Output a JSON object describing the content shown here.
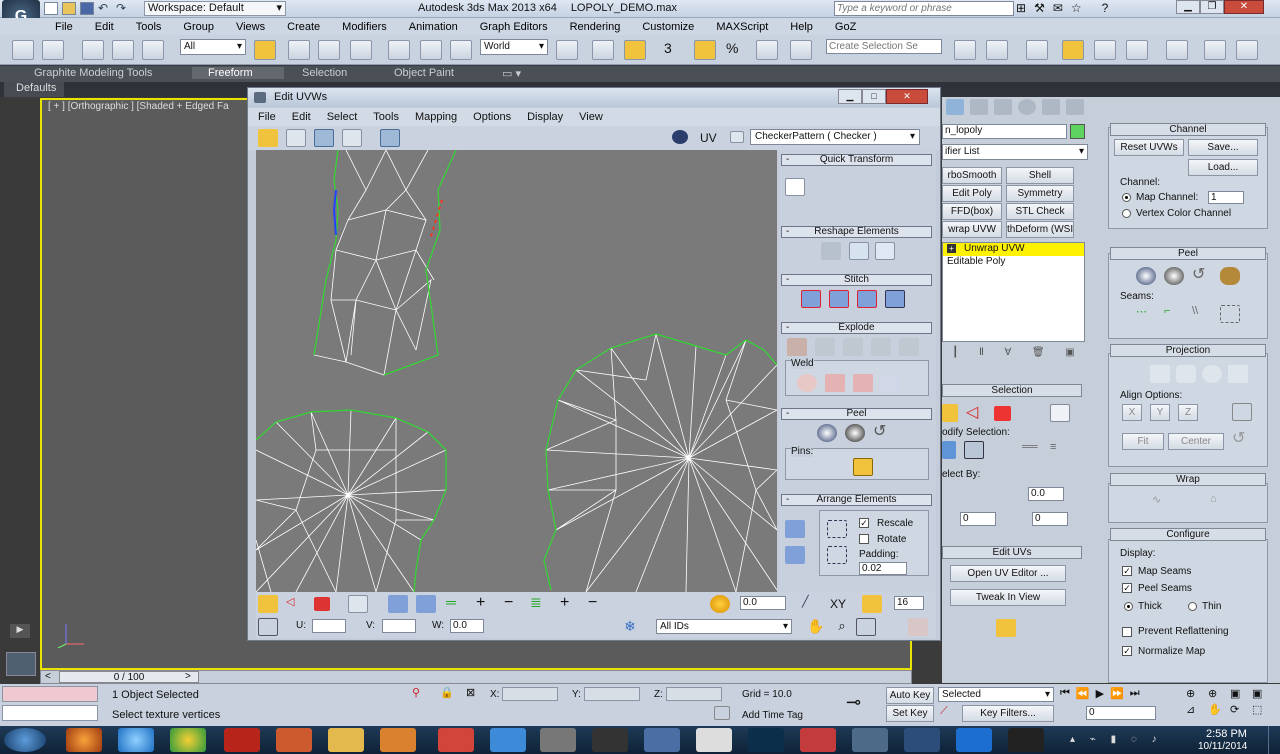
{
  "app": {
    "title": "Autodesk 3ds Max  2013 x64",
    "file": "LOPOLY_DEMO.max",
    "workspace": "Workspace: Default",
    "search_placeholder": "Type a keyword or phrase"
  },
  "menu": [
    "File",
    "Edit",
    "Tools",
    "Group",
    "Views",
    "Create",
    "Modifiers",
    "Animation",
    "Graph Editors",
    "Rendering",
    "Customize",
    "MAXScript",
    "Help",
    "GoZ"
  ],
  "toolbar": {
    "selection_filter": "All",
    "ref_coord": "World",
    "named_selection_placeholder": "Create Selection Se",
    "snap_number": "3",
    "angle_symbol": "%"
  },
  "ribbon": {
    "tabs": [
      "Graphite Modeling Tools",
      "Freeform",
      "Selection",
      "Object Paint"
    ],
    "defaults": "Defaults"
  },
  "viewport": {
    "label": "[ + ] [Orthographic ] [Shaded + Edged Fa"
  },
  "time_slider": {
    "value": "0 / 100"
  },
  "edit_uvws": {
    "title": "Edit UVWs",
    "menu": [
      "File",
      "Edit",
      "Select",
      "Tools",
      "Mapping",
      "Options",
      "Display",
      "View"
    ],
    "uv_label": "UV",
    "texture": "CheckerPattern  ( Checker )",
    "sections": {
      "quick_transform": "Quick Transform",
      "reshape": "Reshape Elements",
      "stitch": "Stitch",
      "explode": "Explode",
      "weld": "Weld",
      "peel": "Peel",
      "pins": "Pins:",
      "arrange": "Arrange Elements"
    },
    "arrange": {
      "rescale": "Rescale",
      "rescale_checked": true,
      "rotate": "Rotate",
      "rotate_checked": false,
      "padding_label": "Padding:",
      "padding": "0.02"
    },
    "bottom": {
      "spin1": "0.0",
      "xy": "XY",
      "spin2": "16",
      "u_label": "U:",
      "v_label": "V:",
      "w_label": "W:",
      "w_value": "0.0",
      "ids": "All IDs"
    }
  },
  "modifier_panel": {
    "object_name": "n_lopoly",
    "modifier_list": "ifier List",
    "buttons": [
      "rboSmooth",
      "Shell",
      "Edit Poly",
      "Symmetry",
      "FFD(box)",
      "STL Check",
      "wrap UVW",
      "thDeform (WSI"
    ],
    "stack": [
      "Unwrap UVW",
      "Editable Poly"
    ],
    "selection_hdr": "Selection",
    "modify_selection": "odify Selection:",
    "select_by": "elect By:",
    "select_by_val": "0.0",
    "spin_a": "0",
    "spin_b": "0",
    "edit_uvs_hdr": "Edit UVs",
    "open_uv_editor": "Open UV Editor ...",
    "tweak_in_view": "Tweak In View"
  },
  "channel_panel": {
    "channel_hdr": "Channel",
    "reset_uvws": "Reset UVWs",
    "save": "Save...",
    "load": "Load...",
    "channel_label": "Channel:",
    "map_channel": "Map Channel:",
    "map_channel_value": "1",
    "vertex_color": "Vertex Color Channel",
    "peel_hdr": "Peel",
    "seams_label": "Seams:",
    "projection_hdr": "Projection",
    "align_options": "Align Options:",
    "align_x": "X",
    "align_y": "Y",
    "align_z": "Z",
    "fit": "Fit",
    "center": "Center",
    "wrap_hdr": "Wrap",
    "configure_hdr": "Configure",
    "display_label": "Display:",
    "map_seams": "Map Seams",
    "peel_seams": "Peel Seams",
    "thick": "Thick",
    "thin": "Thin",
    "prevent_reflattening": "Prevent Reflattening",
    "normalize_map": "Normalize Map"
  },
  "status": {
    "selected": "1 Object Selected",
    "prompt": "Select texture vertices",
    "x_label": "X:",
    "y_label": "Y:",
    "z_label": "Z:",
    "grid": "Grid = 10.0",
    "add_time_tag": "Add Time Tag",
    "auto_key": "Auto Key",
    "set_key": "Set Key",
    "key_mode": "Selected",
    "key_filters": "Key Filters...",
    "frame": "0"
  },
  "clock": {
    "time": "2:58 PM",
    "date": "10/11/2014"
  },
  "colors": {
    "accent_yellow": "#e8e400",
    "uv_green": "#2fd62f",
    "uv_white": "#ffffff",
    "stack_active": "#fff200"
  }
}
